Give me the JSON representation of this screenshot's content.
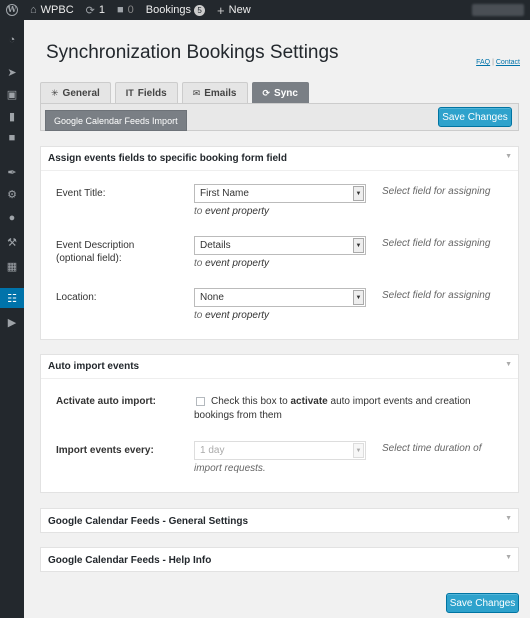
{
  "adminbar": {
    "site_name": "WPBC",
    "updates_count": "1",
    "comments_count": "0",
    "bookings_label": "Bookings",
    "bookings_count": "5",
    "new_label": "New"
  },
  "page": {
    "title": "Synchronization Bookings Settings",
    "faq_link": "FAQ",
    "separator": "|",
    "contact_link": "Contact"
  },
  "tabs": [
    {
      "label": "General",
      "icon": "asterisk-icon"
    },
    {
      "label": "Fields",
      "icon": "text-field-icon"
    },
    {
      "label": "Emails",
      "icon": "envelope-icon"
    },
    {
      "label": "Sync",
      "icon": "refresh-icon"
    }
  ],
  "subtab": {
    "label": "Google Calendar Feeds Import"
  },
  "buttons": {
    "save_changes": "Save Changes"
  },
  "assign_panel": {
    "title": "Assign events fields to specific booking form field",
    "rows": [
      {
        "label": "Event Title:",
        "value": "First Name",
        "hint_a": "Select field for assigning",
        "hint_b": "to",
        "hint_c": "event property"
      },
      {
        "label": "Event Description",
        "label2": "(optional field):",
        "value": "Details",
        "hint_a": "Select field for assigning",
        "hint_b": "to",
        "hint_c": "event property"
      },
      {
        "label": "Location:",
        "value": "None",
        "hint_a": "Select field for assigning",
        "hint_b": "to",
        "hint_c": "event property"
      }
    ]
  },
  "auto_import_panel": {
    "title": "Auto import events",
    "activate_label": "Activate auto import:",
    "checkbox_text_a": "Check this box to",
    "checkbox_text_bold": "activate",
    "checkbox_text_b": "auto import events and creation",
    "checkbox_text_c": "bookings from them",
    "every_label": "Import events every:",
    "every_value": "1 day",
    "every_hint_a": "Select time duration of",
    "every_hint_b": "import requests."
  },
  "general_settings_panel": {
    "title": "Google Calendar Feeds - General Settings"
  },
  "help_panel": {
    "title": "Google Calendar Feeds - Help Info"
  },
  "colors": {
    "primary_button": "#2ea2cc",
    "admin_bar": "#23282d",
    "active_menu": "#0073aa"
  }
}
